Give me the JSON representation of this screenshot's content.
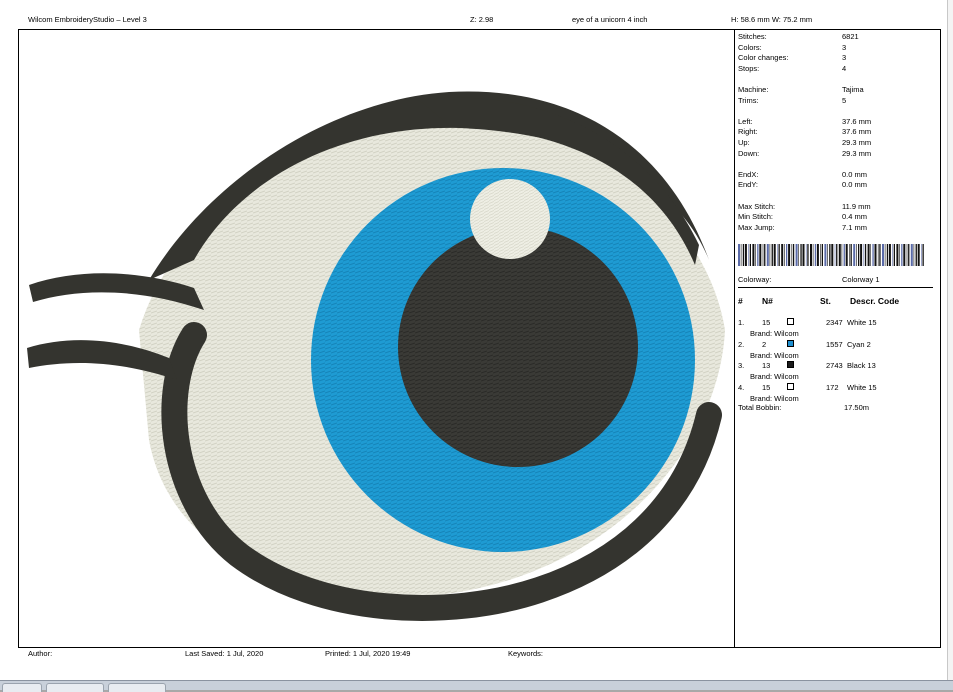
{
  "header": {
    "app": "Wilcom EmbroideryStudio – Level 3",
    "zoom": "Z: 2.98",
    "design_name": "eye of a unicorn 4 inch",
    "dimensions": "H: 58.6 mm   W: 75.2 mm"
  },
  "stats": [
    {
      "label": "Stitches:",
      "value": "6821"
    },
    {
      "label": "Colors:",
      "value": "3"
    },
    {
      "label": "Color changes:",
      "value": "3"
    },
    {
      "label": "Stops:",
      "value": "4"
    },
    {
      "label": "Machine:",
      "value": "Tajima"
    },
    {
      "label": "Trims:",
      "value": "5"
    },
    {
      "label": "Left:",
      "value": "37.6 mm"
    },
    {
      "label": "Right:",
      "value": "37.6 mm"
    },
    {
      "label": "Up:",
      "value": "29.3 mm"
    },
    {
      "label": "Down:",
      "value": "29.3 mm"
    },
    {
      "label": "EndX:",
      "value": "0.0 mm"
    },
    {
      "label": "EndY:",
      "value": "0.0 mm"
    },
    {
      "label": "Max Stitch:",
      "value": "11.9 mm"
    },
    {
      "label": "Min Stitch:",
      "value": "0.4 mm"
    },
    {
      "label": "Max Jump:",
      "value": "7.1 mm"
    }
  ],
  "colorway": {
    "label": "Colorway:",
    "value": "Colorway 1"
  },
  "table": {
    "headers": {
      "num": "#",
      "needle": "N#",
      "stitches": "St.",
      "desc": "Descr. Code"
    },
    "rows": [
      {
        "idx": "1.",
        "needle": "15",
        "color": "#ffffff",
        "stitches": "2347",
        "desc": "White 15",
        "brand": "Brand: Wilcom"
      },
      {
        "idx": "2.",
        "needle": "2",
        "color": "#1e8fd0",
        "stitches": "1557",
        "desc": "Cyan 2",
        "brand": "Brand: Wilcom"
      },
      {
        "idx": "3.",
        "needle": "13",
        "color": "#1a1a1a",
        "stitches": "2743",
        "desc": "Black 13",
        "brand": "Brand: Wilcom"
      },
      {
        "idx": "4.",
        "needle": "15",
        "color": "#ffffff",
        "stitches": "172",
        "desc": "White 15",
        "brand": "Brand: Wilcom"
      }
    ]
  },
  "bobbin": {
    "label": "Total Bobbin:",
    "value": "17.50m"
  },
  "footer": {
    "author": "Author:",
    "last_saved": "Last Saved:  1 Jul, 2020",
    "printed": "Printed:  1 Jul, 2020 19:49",
    "keywords": "Keywords:"
  },
  "colors": {
    "outline": "#34342f",
    "sclera": "#e8e8dd",
    "iris": "#1e9bd3",
    "pupil": "#3a3a36",
    "highlight": "#eeeee4"
  }
}
